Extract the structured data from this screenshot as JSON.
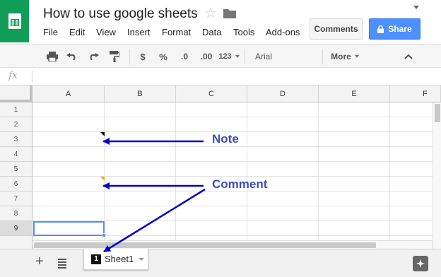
{
  "header": {
    "title": "How to use google sheets",
    "menu": [
      "File",
      "Edit",
      "View",
      "Insert",
      "Format",
      "Data",
      "Tools",
      "Add-ons"
    ],
    "comments_label": "Comments",
    "share_label": "Share"
  },
  "toolbar": {
    "currency": "$",
    "percent": "%",
    "decrease_decimals": ".0",
    "increase_decimals": ".00",
    "number_format": "123",
    "font": "Arial",
    "more": "More"
  },
  "formula_bar": {
    "fx": "fx",
    "value": ""
  },
  "grid": {
    "columns": [
      "A",
      "B",
      "C",
      "D",
      "E",
      "F"
    ],
    "rows": [
      "1",
      "2",
      "3",
      "4",
      "5",
      "6",
      "7",
      "8",
      "9"
    ],
    "selected_cell": "A9"
  },
  "sheets": {
    "tabs": [
      {
        "badge": "1",
        "name": "Sheet1"
      }
    ]
  },
  "annotations": {
    "note": "Note",
    "comment": "Comment",
    "color": "#2a2ad4"
  },
  "colors": {
    "brand": "#0f9d58",
    "share": "#4d90fe",
    "note_marker": "#000000",
    "comment_marker": "#f6a800"
  }
}
